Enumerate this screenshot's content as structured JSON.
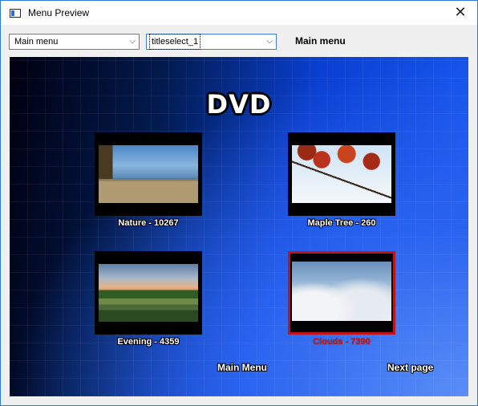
{
  "window": {
    "title": "Menu Preview",
    "close_glyph": "✕"
  },
  "toolbar": {
    "menu_select": {
      "value": "Main menu",
      "chevron": "⌵"
    },
    "title_select": {
      "value": "titleselect_1",
      "chevron": "⌵"
    },
    "current_menu_label": "Main menu"
  },
  "preview": {
    "logo_text": "DVD",
    "items": [
      {
        "caption": "Nature - 10267",
        "image": "beach-cliffs-photo",
        "selected": false
      },
      {
        "caption": "Maple Tree - 260",
        "image": "red-maple-branch-photo",
        "selected": false
      },
      {
        "caption": "Evening - 4359",
        "image": "evening-meadow-photo",
        "selected": false
      },
      {
        "caption": "Clouds - 7390",
        "image": "sea-of-clouds-photo",
        "selected": true
      }
    ],
    "main_menu_button": "Main Menu",
    "next_page_button": "Next page"
  },
  "colors": {
    "window_border": "#2b79d8",
    "selection_border": "#c0141a",
    "selected_caption": "#d01a1a",
    "background_blue": "#1a5cf5"
  }
}
